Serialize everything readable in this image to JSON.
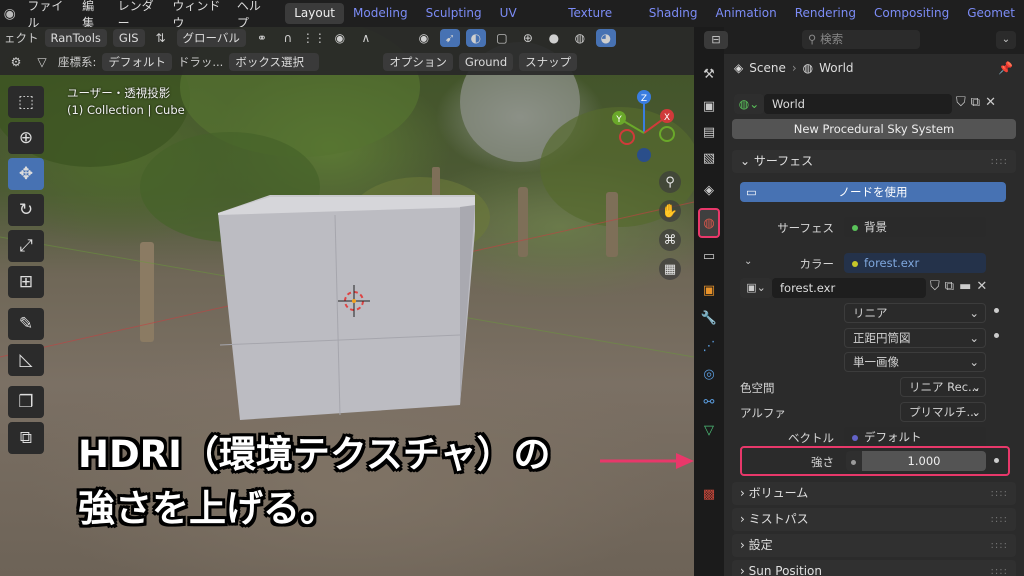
{
  "menubar": {
    "logo": "blender-logo-icon",
    "items": [
      "ファイル",
      "編集",
      "レンダー",
      "ウィンドウ",
      "ヘルプ"
    ],
    "workspaces": [
      "Layout",
      "Modeling",
      "Sculpting",
      "UV Editing",
      "Texture Paint",
      "Shading",
      "Animation",
      "Rendering",
      "Compositing",
      "Geomet"
    ],
    "active_workspace": "Layout"
  },
  "viewport_header": {
    "left_label": "ェクト",
    "addons": [
      "RanTools",
      "GIS"
    ],
    "transform_orientation": "グローバル",
    "coord_label": "座標系:",
    "coord_value": "デフォルト",
    "drag_label": "ドラッ...",
    "select_mode": "ボックス選択",
    "options": "オプション",
    "ground": "Ground",
    "snap": "スナップ"
  },
  "viewport": {
    "view_name": "ユーザー・透視投影",
    "collection_info": "(1) Collection | Cube",
    "gizmo": {
      "x": "X",
      "y": "Y",
      "z": "Z"
    }
  },
  "overlay_text": {
    "line1": "HDRI（環境テクスチャ）の",
    "line2": "強さを上げる。",
    "highlight_color": "#e8386a"
  },
  "properties_header": {
    "search_placeholder": "検索"
  },
  "properties": {
    "breadcrumb_scene": "Scene",
    "breadcrumb_world": "World",
    "world_name": "World",
    "sky_button": "New Procedural Sky System",
    "surface_panel": "サーフェス",
    "use_nodes_button": "ノードを使用",
    "surface_label": "サーフェス",
    "surface_value": "背景",
    "color_label": "カラー",
    "color_value": "forest.exr",
    "image_name": "forest.exr",
    "interpolation": "リニア",
    "projection": "正距円筒図",
    "source": "単一画像",
    "colorspace_label": "色空間",
    "colorspace_value": "リニア Rec...",
    "alpha_label": "アルファ",
    "alpha_value": "プリマルチ...",
    "vector_label": "ベクトル",
    "vector_value": "デフォルト",
    "strength_label": "強さ",
    "strength_value": "1.000",
    "panels": [
      "ボリューム",
      "ミストパス",
      "設定",
      "Sun Position"
    ]
  },
  "colors": {
    "accent_blue": "#4772b3",
    "highlight": "#e8386a",
    "surface_dot": "#5ac35a",
    "color_dot": "#c7c729",
    "vector_dot": "#6363c7"
  }
}
